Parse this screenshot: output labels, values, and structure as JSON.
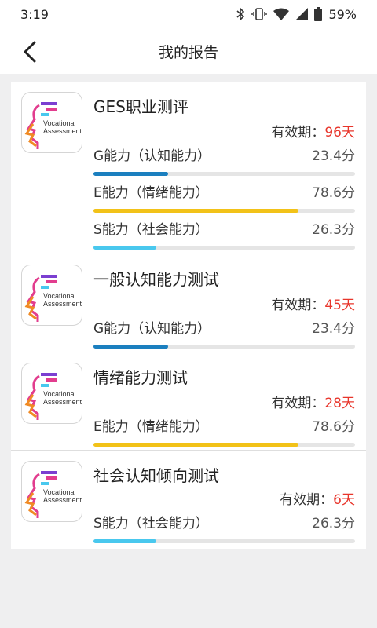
{
  "statusbar": {
    "time": "3:19",
    "battery": "59%"
  },
  "navbar": {
    "title": "我的报告"
  },
  "logo": {
    "line1": "Vocational",
    "line2": "Assessment"
  },
  "validity_label": "有效期：",
  "colors": {
    "g": "#1b7fbf",
    "e": "#f2c218",
    "s": "#49c8ee",
    "days": "#e8352b"
  },
  "reports": [
    {
      "title": "GES职业测评",
      "days": "96天",
      "abilities": [
        {
          "label": "G能力（认知能力）",
          "score": "23.4分",
          "percent": 28.5,
          "color": "g"
        },
        {
          "label": "E能力（情绪能力）",
          "score": "78.6分",
          "percent": 78.5,
          "color": "e"
        },
        {
          "label": "S能力（社会能力）",
          "score": "26.3分",
          "percent": 24,
          "color": "s"
        }
      ]
    },
    {
      "title": "一般认知能力测试",
      "days": "45天",
      "abilities": [
        {
          "label": "G能力（认知能力）",
          "score": "23.4分",
          "percent": 28.5,
          "color": "g"
        }
      ]
    },
    {
      "title": "情绪能力测试",
      "days": "28天",
      "abilities": [
        {
          "label": "E能力（情绪能力）",
          "score": "78.6分",
          "percent": 78.5,
          "color": "e"
        }
      ]
    },
    {
      "title": "社会认知倾向测试",
      "days": "6天",
      "abilities": [
        {
          "label": "S能力（社会能力）",
          "score": "26.3分",
          "percent": 24,
          "color": "s"
        }
      ]
    }
  ]
}
